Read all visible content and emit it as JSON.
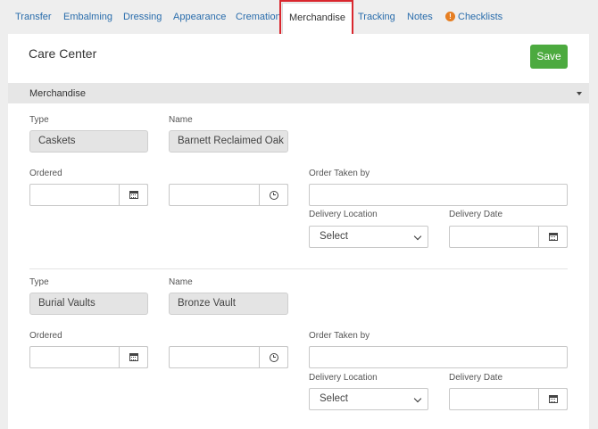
{
  "tabs": [
    {
      "label": "Transfer"
    },
    {
      "label": "Embalming"
    },
    {
      "label": "Dressing"
    },
    {
      "label": "Appearance"
    },
    {
      "label": "Cremation"
    },
    {
      "label": "Merchandise",
      "active": true
    },
    {
      "label": "Tracking"
    },
    {
      "label": "Notes"
    },
    {
      "label": "Checklists",
      "icon": "exclamation-circle-icon",
      "icon_color": "#e67e22"
    }
  ],
  "header": {
    "title": "Care Center",
    "save_label": "Save",
    "save_color": "#4caa3f"
  },
  "section": {
    "title": "Merchandise"
  },
  "items": [
    {
      "type_label": "Type",
      "type_value": "Caskets",
      "name_label": "Name",
      "name_value": "Barnett Reclaimed Oak",
      "ordered_label": "Ordered",
      "ordered_date": "",
      "ordered_time": "",
      "order_taken_label": "Order Taken by",
      "order_taken_value": "",
      "delivery_location_label": "Delivery Location",
      "delivery_location_value": "Select",
      "delivery_date_label": "Delivery Date",
      "delivery_date_value": ""
    },
    {
      "type_label": "Type",
      "type_value": "Burial Vaults",
      "name_label": "Name",
      "name_value": "Bronze Vault",
      "ordered_label": "Ordered",
      "ordered_date": "",
      "ordered_time": "",
      "order_taken_label": "Order Taken by",
      "order_taken_value": "",
      "delivery_location_label": "Delivery Location",
      "delivery_location_value": "Select",
      "delivery_date_label": "Delivery Date",
      "delivery_date_value": ""
    }
  ],
  "colors": {
    "link": "#2a6dac",
    "highlight": "#d9272e"
  }
}
